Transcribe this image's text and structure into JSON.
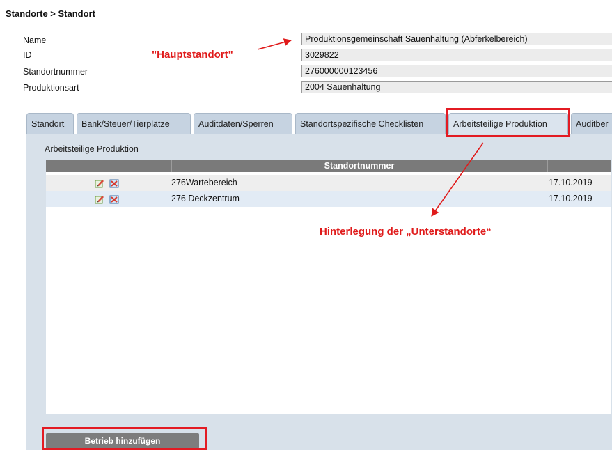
{
  "breadcrumb": "Standorte > Standort",
  "form": {
    "fields": [
      {
        "label": "Name",
        "value": "Produktionsgemeinschaft Sauenhaltung (Abferkelbereich)"
      },
      {
        "label": "ID",
        "value": "3029822"
      },
      {
        "label": "Standortnummer",
        "value": "276000000123456"
      },
      {
        "label": "Produktionsart",
        "value": "2004 Sauenhaltung"
      }
    ]
  },
  "annotations": {
    "hauptstandort": "\"Hauptstandort\"",
    "unterstandorte": "Hinterlegung der „Unterstandorte“",
    "color": "#e01b1b"
  },
  "tabs": [
    {
      "label": "Standort"
    },
    {
      "label": "Bank/Steuer/Tierplätze"
    },
    {
      "label": "Auditdaten/Sperren"
    },
    {
      "label": "Standortspezifische Checklisten"
    },
    {
      "label": "Arbeitsteilige Produktion",
      "active": true
    },
    {
      "label": "Auditber"
    }
  ],
  "panel": {
    "title": "Arbeitsteilige Produktion",
    "table": {
      "header": "Standortnummer",
      "rows": [
        {
          "name": "276Wartebereich",
          "date": "17.10.2019",
          "icons": [
            "edit-icon",
            "delete-icon"
          ]
        },
        {
          "name": "276 Deckzentrum",
          "date": "17.10.2019",
          "icons": [
            "edit-icon",
            "delete-icon"
          ]
        }
      ]
    },
    "add_button": "Betrieb hinzufügen"
  }
}
